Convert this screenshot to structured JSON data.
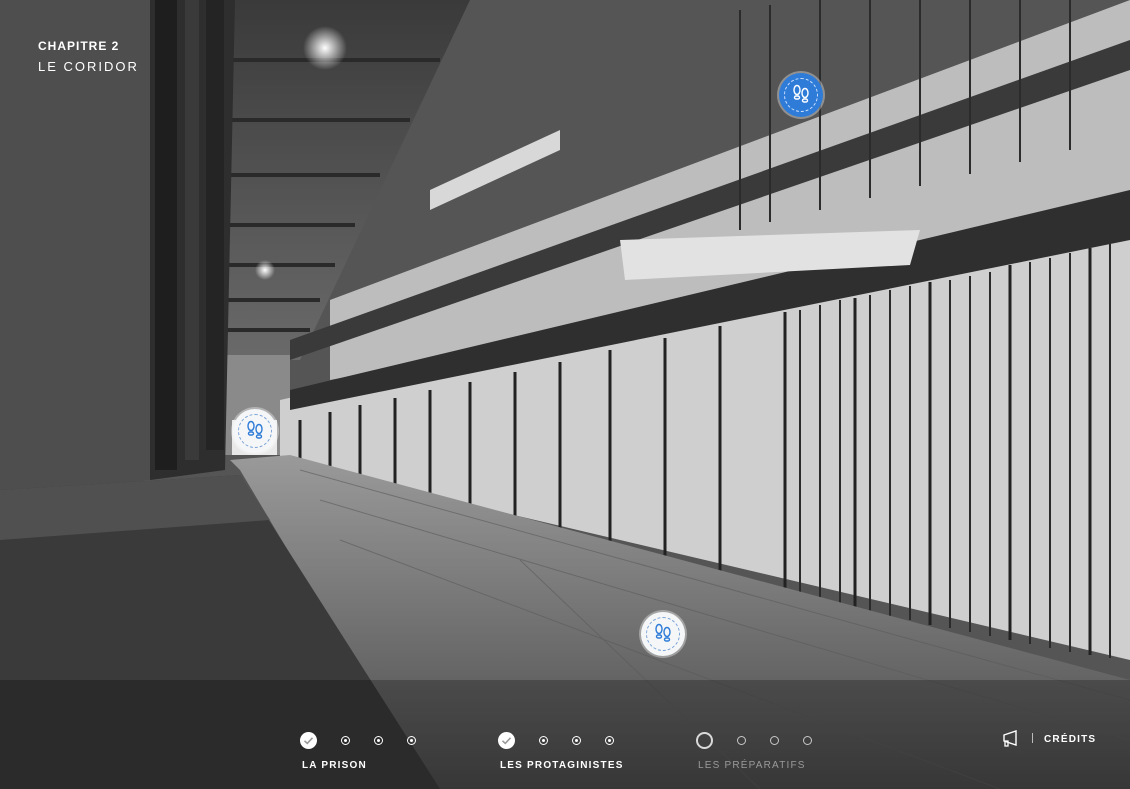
{
  "chapter": {
    "number_label": "CHAPITRE 2",
    "title": "LE CORIDOR"
  },
  "hotspots": [
    {
      "name": "footsteps-hotspot-upper",
      "state": "active"
    },
    {
      "name": "footsteps-hotspot-left",
      "state": "default"
    },
    {
      "name": "footsteps-hotspot-floor",
      "state": "default"
    }
  ],
  "progress": {
    "groups": [
      {
        "label": "LA PRISON",
        "status": "done",
        "dots": 3
      },
      {
        "label": "LES PROTAGINISTES",
        "status": "done",
        "dots": 3
      },
      {
        "label": "LES PRÉPARATIFS",
        "status": "current",
        "dots": 3
      }
    ]
  },
  "credits": {
    "label": "CRÉDITS",
    "icon": "megaphone-icon"
  },
  "colors": {
    "accent": "#2f7cd8",
    "hotspot_bg": "#f4f6f8",
    "muted_text": "#9a9a9a"
  }
}
